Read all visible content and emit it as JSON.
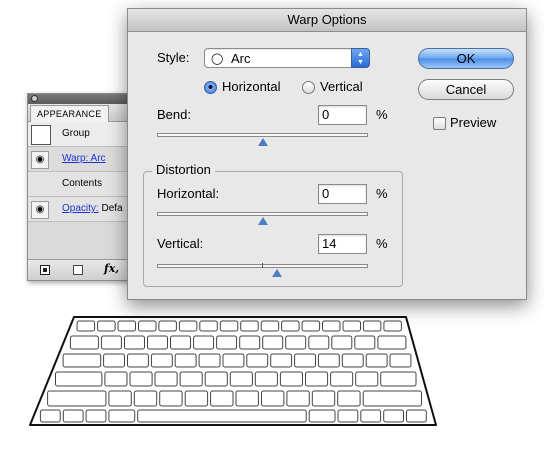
{
  "appearance_panel": {
    "tab_label": "APPEARANCE",
    "rows": [
      {
        "label": "Group"
      },
      {
        "label": "Warp: Arc"
      },
      {
        "label": "Contents"
      },
      {
        "label": "Opacity:",
        "value": "Defa"
      }
    ],
    "fx_label": "fx,"
  },
  "dialog": {
    "title": "Warp Options",
    "style_label": "Style:",
    "style_value": "Arc",
    "style_icon": "arc-shape-icon",
    "orientation": {
      "horizontal_label": "Horizontal",
      "vertical_label": "Vertical",
      "selected": "Horizontal"
    },
    "bend": {
      "label": "Bend:",
      "value": "0",
      "unit": "%",
      "slider_fraction": 0.5
    },
    "distortion": {
      "legend": "Distortion",
      "horizontal": {
        "label": "Horizontal:",
        "value": "0",
        "unit": "%",
        "slider_fraction": 0.5
      },
      "vertical": {
        "label": "Vertical:",
        "value": "14",
        "unit": "%",
        "slider_fraction": 0.57
      }
    },
    "buttons": {
      "ok": "OK",
      "cancel": "Cancel"
    },
    "preview": {
      "label": "Preview",
      "checked": false
    }
  }
}
